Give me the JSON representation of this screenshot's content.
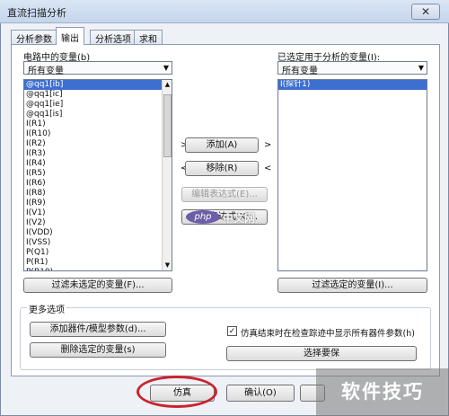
{
  "window": {
    "title": "直流扫描分析",
    "close_glyph": "✕"
  },
  "tabs": [
    "分析参数",
    "输出",
    "分析选项",
    "求和"
  ],
  "left": {
    "label": "电路中的变量(b)",
    "filter_value": "所有变量",
    "items": [
      "@qq1[ib]",
      "@qq1[ic]",
      "@qq1[ie]",
      "@qq1[is]",
      "I(R1)",
      "I(R10)",
      "I(R2)",
      "I(R3)",
      "I(R4)",
      "I(R5)",
      "I(R6)",
      "I(R8)",
      "I(R9)",
      "I(V1)",
      "I(V2)",
      "I(VDD)",
      "I(VSS)",
      "P(Q1)",
      "P(R1)",
      "P(R10)"
    ],
    "filter_button": "过滤未选定的变量(F)..."
  },
  "right": {
    "label": "已选定用于分析的变量(I):",
    "filter_value": "所有变量",
    "items": [
      "I(探针1)"
    ],
    "filter_button": "过滤选定的变量(I)..."
  },
  "middle": {
    "left_arrow": ">",
    "right_arrow": ">",
    "back_arrow_left": "<",
    "back_arrow_right": "<",
    "add": "添加(A)",
    "remove": "移除(R)",
    "edit_expression": "编辑表达式(E)...",
    "add_expression": "添加表达式(X)..."
  },
  "more": {
    "legend": "更多选项",
    "add_device_param": "添加器件/模型参数(d)...",
    "delete_selected": "删除选定的变量(s)",
    "checkbox_label": "仿真结束时在检查踪迹中显示所有器件参数(h)",
    "checkbox_glyph": "✓",
    "select_button": "选择要保"
  },
  "bottom": {
    "simulate": "仿真",
    "ok": "确认(O)"
  },
  "watermarks": {
    "php_logo_text": "php",
    "php_cn": "中文网",
    "corner_text": "软件技巧"
  },
  "colors": {
    "selection": "#3d6fd0",
    "annotation": "#c9242f"
  }
}
